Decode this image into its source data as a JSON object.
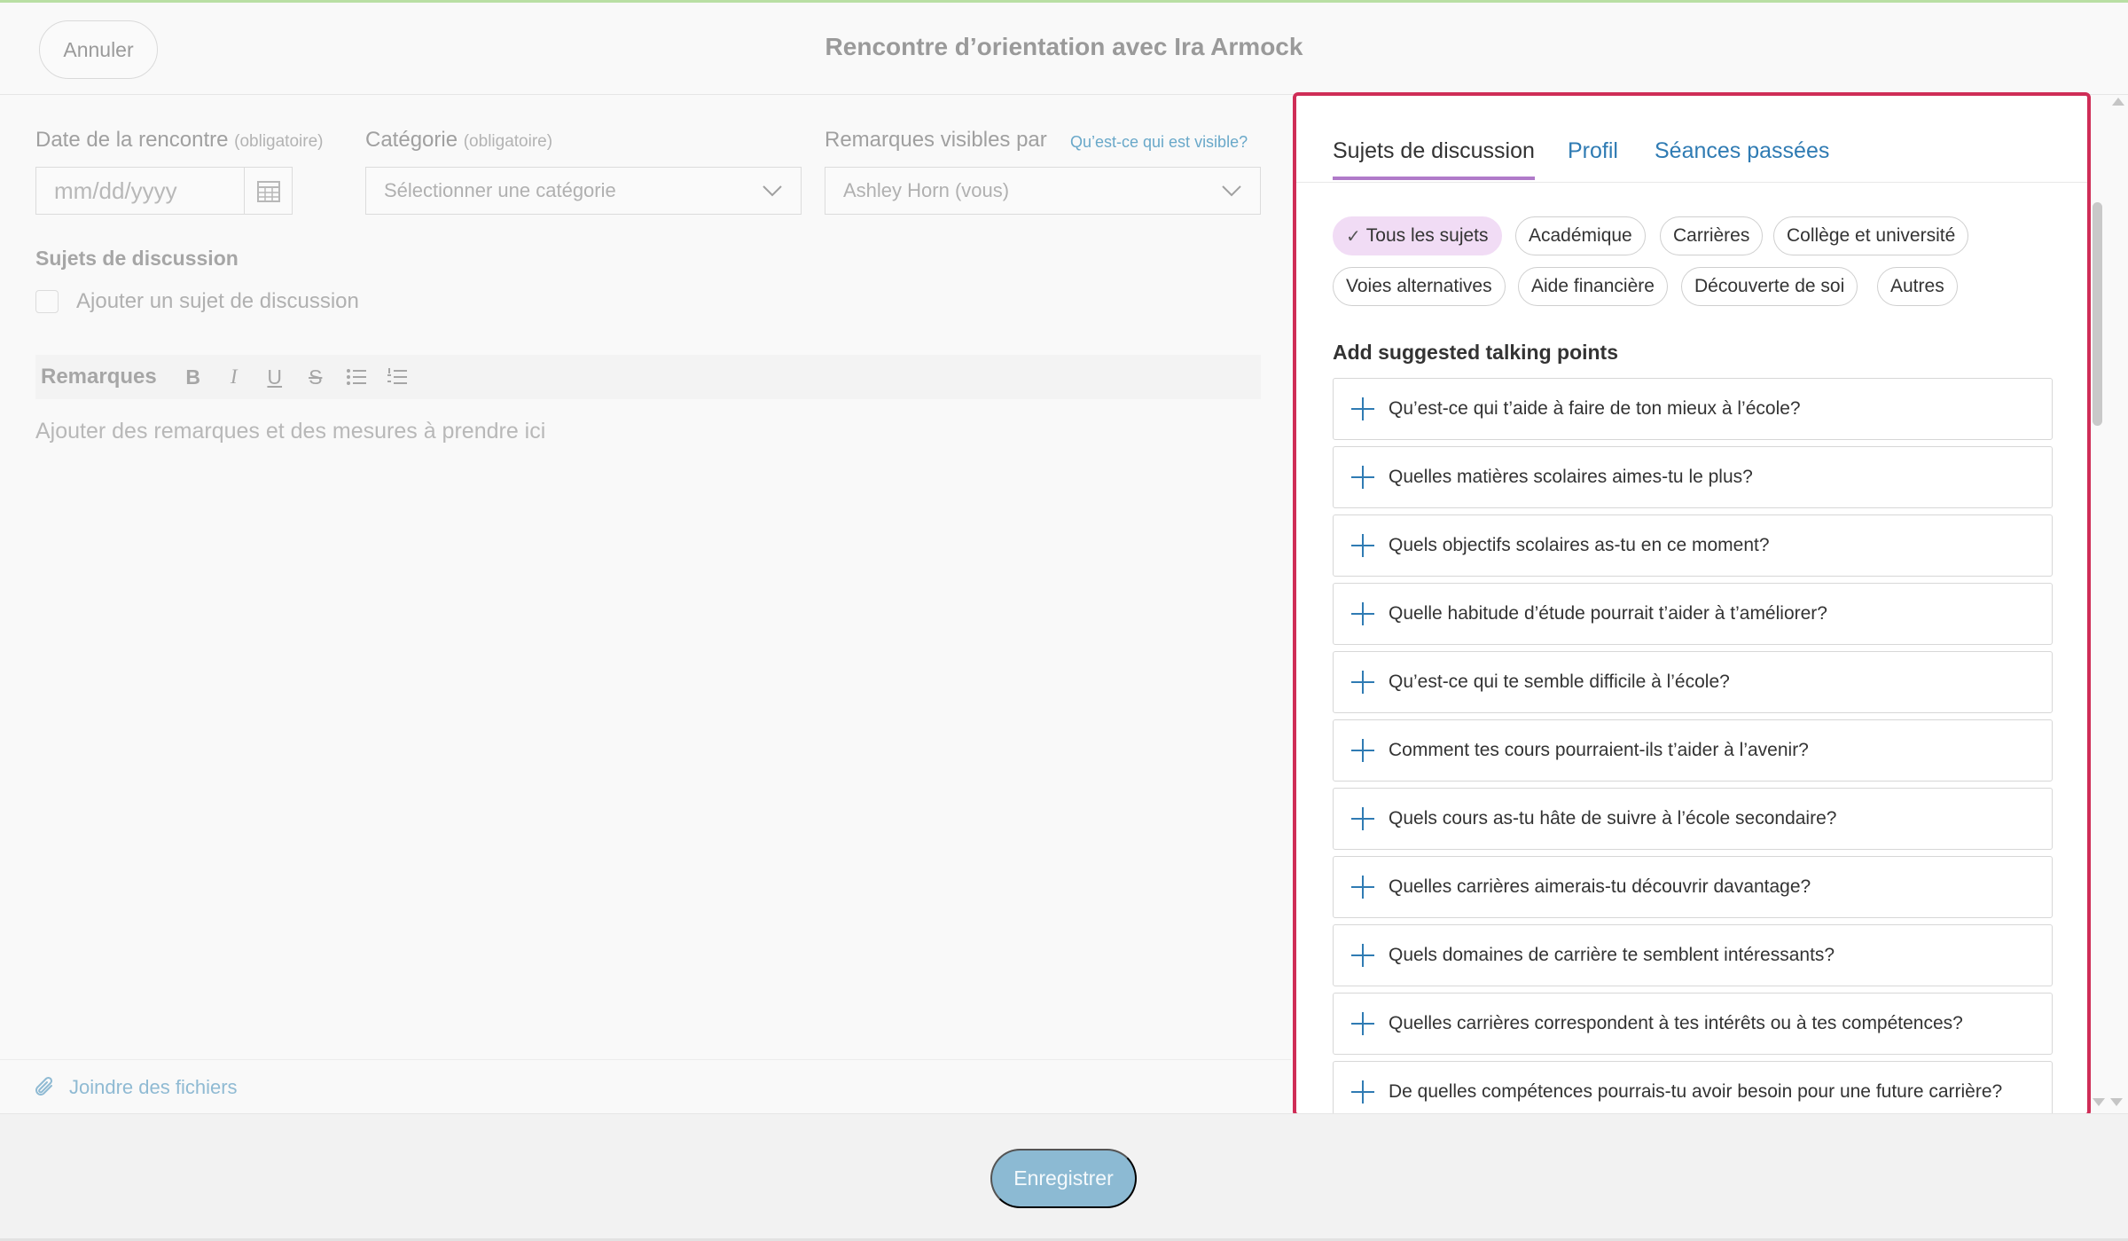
{
  "header": {
    "cancel_label": "Annuler",
    "title": "Rencontre d’orientation avec Ira Armock"
  },
  "form": {
    "date_label": "Date de la rencontre",
    "date_required": "(obligatoire)",
    "date_placeholder": "mm/dd/yyyy",
    "category_label": "Catégorie",
    "category_required": "(obligatoire)",
    "category_placeholder": "Sélectionner une catégorie",
    "visibility_label": "Remarques visibles par",
    "visibility_link": "Qu’est-ce qui est visible?",
    "visibility_value": "Ashley Horn (vous)",
    "topics_title": "Sujets de discussion",
    "add_topic_label": "Ajouter un sujet de discussion",
    "notes_label": "Remarques",
    "toolbar": {
      "bold": "B",
      "italic": "I",
      "underline": "U",
      "strike": "S"
    },
    "notes_placeholder": "Ajouter des remarques et des mesures à prendre ici",
    "attach_label": "Joindre des fichiers"
  },
  "footer": {
    "save_label": "Enregistrer"
  },
  "panel": {
    "tabs": [
      {
        "label": "Sujets de discussion",
        "active": true
      },
      {
        "label": "Profil",
        "active": false
      },
      {
        "label": "Séances passées",
        "active": false
      }
    ],
    "chips": [
      {
        "label": "Tous les sujets",
        "selected": true
      },
      {
        "label": "Académique",
        "selected": false
      },
      {
        "label": "Carrières",
        "selected": false
      },
      {
        "label": "Collège et université",
        "selected": false
      },
      {
        "label": "Voies alternatives",
        "selected": false
      },
      {
        "label": "Aide financière",
        "selected": false
      },
      {
        "label": "Découverte de soi",
        "selected": false
      },
      {
        "label": "Autres",
        "selected": false
      }
    ],
    "suggest_title": "Add suggested talking points",
    "points": [
      "Qu’est-ce qui t’aide à faire de ton mieux à l’école?",
      "Quelles matières scolaires aimes-tu le plus?",
      "Quels objectifs scolaires as-tu en ce moment?",
      "Quelle habitude d’étude pourrait t’aider à t’améliorer?",
      "Qu’est-ce qui te semble difficile à l’école?",
      "Comment tes cours pourraient-ils t’aider à l’avenir?",
      "Quels cours as-tu hâte de suivre à l’école secondaire?",
      "Quelles carrières aimerais-tu découvrir davantage?",
      "Quels domaines de carrière te semblent intéressants?",
      "Quelles carrières correspondent à tes intérêts ou à tes compétences?",
      "De quelles compétences pourrais-tu avoir besoin pour une future carrière?"
    ]
  },
  "colors": {
    "accent_blue": "#2f7bb3",
    "active_tab_underline": "#b07ac9",
    "selected_chip": "#f1dcf5",
    "panel_highlight_border": "#cf2d57",
    "save_button": "#8cbad3"
  },
  "icons": {
    "calendar": "calendar-icon",
    "chevron": "chevron-down-icon",
    "paperclip": "paperclip-icon",
    "plus": "plus-icon",
    "check": "check-icon",
    "bullet_list": "bullet-list-icon",
    "numbered_list": "numbered-list-icon"
  }
}
